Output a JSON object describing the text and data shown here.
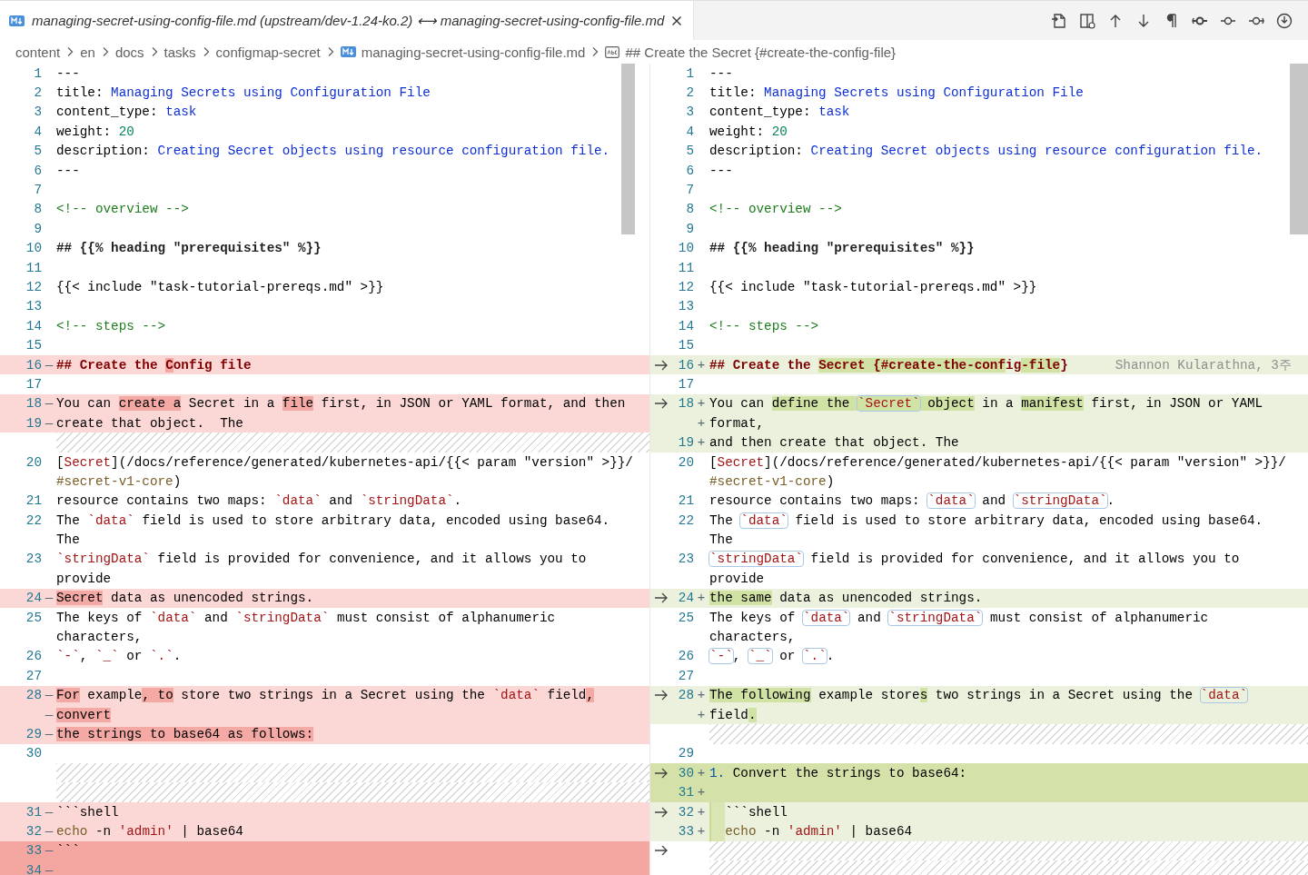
{
  "tab": {
    "title": "managing-secret-using-config-file.md (upstream/dev-1.24-ko.2) ⟷ managing-secret-using-config-file.md",
    "selected": true
  },
  "breadcrumbs": [
    {
      "label": "content",
      "kind": "folder"
    },
    {
      "label": "en",
      "kind": "folder"
    },
    {
      "label": "docs",
      "kind": "folder"
    },
    {
      "label": "tasks",
      "kind": "folder"
    },
    {
      "label": "configmap-secret",
      "kind": "folder"
    },
    {
      "label": "managing-secret-using-config-file.md",
      "kind": "file"
    },
    {
      "label": "## Create the Secret {#create-the-config-file}",
      "kind": "symbol"
    }
  ],
  "panes": [
    {
      "boxed_code": false,
      "rows": [
        {
          "kind": "plain",
          "num": "1",
          "segs": [
            {
              "text": "---"
            }
          ]
        },
        {
          "kind": "plain",
          "num": "2",
          "segs": [
            {
              "text": "title: "
            },
            {
              "text": "Managing Secrets using Configuration File",
              "kind": "value"
            }
          ]
        },
        {
          "kind": "plain",
          "num": "3",
          "segs": [
            {
              "text": "content_type: "
            },
            {
              "text": "task",
              "kind": "value"
            }
          ]
        },
        {
          "kind": "plain",
          "num": "4",
          "segs": [
            {
              "text": "weight: "
            },
            {
              "text": "20",
              "kind": "number"
            }
          ]
        },
        {
          "kind": "plain",
          "num": "5",
          "segs": [
            {
              "text": "description: "
            },
            {
              "text": "Creating Secret objects using resource configuration file.",
              "kind": "value"
            }
          ]
        },
        {
          "kind": "plain",
          "num": "6",
          "segs": [
            {
              "text": "---"
            }
          ]
        },
        {
          "kind": "plain",
          "num": "7",
          "segs": []
        },
        {
          "kind": "plain",
          "num": "8",
          "segs": [
            {
              "text": "<!-- overview -->",
              "kind": "comment"
            }
          ]
        },
        {
          "kind": "plain",
          "num": "9",
          "segs": []
        },
        {
          "kind": "plain",
          "num": "10",
          "segs": [
            {
              "text": "## {{% heading \"prerequisites\" %}}",
              "kind": "strong"
            }
          ]
        },
        {
          "kind": "plain",
          "num": "11",
          "segs": []
        },
        {
          "kind": "plain",
          "num": "12",
          "segs": [
            {
              "text": "{{< include \"task-tutorial-prereqs.md\" >}}"
            }
          ]
        },
        {
          "kind": "plain",
          "num": "13",
          "segs": []
        },
        {
          "kind": "plain",
          "num": "14",
          "segs": [
            {
              "text": "<!-- steps -->",
              "kind": "comment"
            }
          ]
        },
        {
          "kind": "plain",
          "num": "15",
          "segs": []
        },
        {
          "kind": "removed",
          "num": "16",
          "sign": "—",
          "segs": [
            {
              "text": "## Create the ",
              "kind": "heading"
            },
            {
              "text": "C",
              "kind": "heading",
              "changed": true
            },
            {
              "text": "onfig file",
              "kind": "heading"
            }
          ]
        },
        {
          "kind": "plain",
          "num": "17",
          "segs": []
        },
        {
          "kind": "removed",
          "num": "18",
          "sign": "—",
          "segs": [
            {
              "text": "You can "
            },
            {
              "text": "create a",
              "changed": true
            },
            {
              "text": " Secret in a "
            },
            {
              "text": "file",
              "changed": true
            },
            {
              "text": " first, in JSON or YAML format, and then"
            }
          ]
        },
        {
          "kind": "removed",
          "num": "19",
          "sign": "—",
          "segs": [
            {
              "text": "create that object.  The"
            }
          ]
        },
        {
          "kind": "filler"
        },
        {
          "kind": "plain",
          "num": "20",
          "segs": [
            {
              "text": "["
            },
            {
              "text": "Secret",
              "kind": "link"
            },
            {
              "text": "](/docs/reference/generated/kubernetes-api/{{< param \"version\" >}}/"
            }
          ]
        },
        {
          "kind": "plain",
          "segs": [
            {
              "text": "#secret-v1-core",
              "kind": "anchor"
            },
            {
              "text": ")"
            }
          ]
        },
        {
          "kind": "plain",
          "num": "21",
          "segs": [
            {
              "text": "resource contains two maps: "
            },
            {
              "text": "`data`",
              "kind": "code"
            },
            {
              "text": " and "
            },
            {
              "text": "`stringData`",
              "kind": "code"
            },
            {
              "text": "."
            }
          ]
        },
        {
          "kind": "plain",
          "num": "22",
          "segs": [
            {
              "text": "The "
            },
            {
              "text": "`data`",
              "kind": "code"
            },
            {
              "text": " field is used to store arbitrary data, encoded using base64."
            }
          ]
        },
        {
          "kind": "plain",
          "segs": [
            {
              "text": "The"
            }
          ]
        },
        {
          "kind": "plain",
          "num": "23",
          "segs": [
            {
              "text": "`stringData`",
              "kind": "code"
            },
            {
              "text": " field is provided for convenience, and it allows you to"
            }
          ]
        },
        {
          "kind": "plain",
          "segs": [
            {
              "text": "provide"
            }
          ]
        },
        {
          "kind": "removed",
          "num": "24",
          "sign": "—",
          "segs": [
            {
              "text": "Secret",
              "changed": true
            },
            {
              "text": " data as unencoded strings."
            }
          ]
        },
        {
          "kind": "plain",
          "num": "25",
          "segs": [
            {
              "text": "The keys of "
            },
            {
              "text": "`data`",
              "kind": "code"
            },
            {
              "text": " and "
            },
            {
              "text": "`stringData`",
              "kind": "code"
            },
            {
              "text": " must consist of alphanumeric"
            }
          ]
        },
        {
          "kind": "plain",
          "segs": [
            {
              "text": "characters,"
            }
          ]
        },
        {
          "kind": "plain",
          "num": "26",
          "segs": [
            {
              "text": "`-`",
              "kind": "code"
            },
            {
              "text": ", "
            },
            {
              "text": "`_`",
              "kind": "code"
            },
            {
              "text": " or "
            },
            {
              "text": "`.`",
              "kind": "code"
            },
            {
              "text": "."
            }
          ]
        },
        {
          "kind": "plain",
          "num": "27",
          "segs": []
        },
        {
          "kind": "removed",
          "num": "28",
          "sign": "—",
          "segs": [
            {
              "text": "For",
              "changed": true
            },
            {
              "text": " example"
            },
            {
              "text": ", to",
              "changed": true
            },
            {
              "text": " store two strings in a Secret using the "
            },
            {
              "text": "`data`",
              "kind": "code"
            },
            {
              "text": " field"
            },
            {
              "text": ",",
              "changed": true
            }
          ]
        },
        {
          "kind": "removed",
          "sign": "—",
          "segs": [
            {
              "text": "convert",
              "changed": true
            }
          ]
        },
        {
          "kind": "removed",
          "num": "29",
          "sign": "—",
          "segs": [
            {
              "text": "the strings to base64 as follows:",
              "changed": true
            }
          ]
        },
        {
          "kind": "plain",
          "num": "30",
          "segs": []
        },
        {
          "kind": "filler"
        },
        {
          "kind": "filler"
        },
        {
          "kind": "removed",
          "num": "31",
          "sign": "—",
          "segs": [
            {
              "text": "```shell"
            }
          ]
        },
        {
          "kind": "removed",
          "num": "32",
          "sign": "—",
          "segs": [
            {
              "text": "echo",
              "kind": "command"
            },
            {
              "text": " -n "
            },
            {
              "text": "'admin'",
              "kind": "string"
            },
            {
              "text": " | base64"
            }
          ]
        },
        {
          "kind": "removed_full",
          "num": "33",
          "sign": "—",
          "segs": [
            {
              "text": "```"
            }
          ]
        },
        {
          "kind": "removed_full",
          "num": "34",
          "sign": "—",
          "segs": []
        }
      ]
    },
    {
      "boxed_code": true,
      "rows": [
        {
          "kind": "plain",
          "num": "1",
          "segs": [
            {
              "text": "---"
            }
          ]
        },
        {
          "kind": "plain",
          "num": "2",
          "segs": [
            {
              "text": "title: "
            },
            {
              "text": "Managing Secrets using Configuration File",
              "kind": "value"
            }
          ]
        },
        {
          "kind": "plain",
          "num": "3",
          "segs": [
            {
              "text": "content_type: "
            },
            {
              "text": "task",
              "kind": "value"
            }
          ]
        },
        {
          "kind": "plain",
          "num": "4",
          "segs": [
            {
              "text": "weight: "
            },
            {
              "text": "20",
              "kind": "number"
            }
          ]
        },
        {
          "kind": "plain",
          "num": "5",
          "segs": [
            {
              "text": "description: "
            },
            {
              "text": "Creating Secret objects using resource configuration file.",
              "kind": "value"
            }
          ]
        },
        {
          "kind": "plain",
          "num": "6",
          "segs": [
            {
              "text": "---"
            }
          ]
        },
        {
          "kind": "plain",
          "num": "7",
          "segs": []
        },
        {
          "kind": "plain",
          "num": "8",
          "segs": [
            {
              "text": "<!-- overview -->",
              "kind": "comment"
            }
          ]
        },
        {
          "kind": "plain",
          "num": "9",
          "segs": []
        },
        {
          "kind": "plain",
          "num": "10",
          "segs": [
            {
              "text": "## {{% heading \"prerequisites\" %}}",
              "kind": "strong"
            }
          ]
        },
        {
          "kind": "plain",
          "num": "11",
          "segs": []
        },
        {
          "kind": "plain",
          "num": "12",
          "segs": [
            {
              "text": "{{< include \"task-tutorial-prereqs.md\" >}}"
            }
          ]
        },
        {
          "kind": "plain",
          "num": "13",
          "segs": []
        },
        {
          "kind": "plain",
          "num": "14",
          "segs": [
            {
              "text": "<!-- steps -->",
              "kind": "comment"
            }
          ]
        },
        {
          "kind": "plain",
          "num": "15",
          "segs": []
        },
        {
          "kind": "added",
          "arrow": true,
          "num": "16",
          "sign": "+",
          "blame": "Shannon Kularathna, 3주",
          "segs": [
            {
              "text": "## Create the ",
              "kind": "heading"
            },
            {
              "text": "Secret {#create-the-conf",
              "kind": "heading",
              "changed": true
            },
            {
              "text": "ig",
              "kind": "heading"
            },
            {
              "text": "-file",
              "kind": "heading",
              "changed": true
            },
            {
              "text": "}",
              "kind": "heading"
            }
          ]
        },
        {
          "kind": "plain",
          "num": "17",
          "segs": []
        },
        {
          "kind": "added",
          "arrow": true,
          "num": "18",
          "sign": "+",
          "segs": [
            {
              "text": "You can "
            },
            {
              "text": "define the ",
              "changed": true
            },
            {
              "text": "`Secret`",
              "kind": "code",
              "changed": true
            },
            {
              "text": " object",
              "changed": true
            },
            {
              "text": " in a "
            },
            {
              "text": "manifest",
              "changed": true
            },
            {
              "text": " first, in JSON or YAML"
            }
          ]
        },
        {
          "kind": "added",
          "sign": "+",
          "segs": [
            {
              "text": "format,"
            }
          ]
        },
        {
          "kind": "added",
          "num": "19",
          "sign": "+",
          "segs": [
            {
              "text": "and then create that object. The"
            }
          ]
        },
        {
          "kind": "plain",
          "num": "20",
          "segs": [
            {
              "text": "["
            },
            {
              "text": "Secret",
              "kind": "link"
            },
            {
              "text": "](/docs/reference/generated/kubernetes-api/{{< param \"version\" >}}/"
            }
          ]
        },
        {
          "kind": "plain",
          "segs": [
            {
              "text": "#secret-v1-core",
              "kind": "anchor"
            },
            {
              "text": ")"
            }
          ]
        },
        {
          "kind": "plain",
          "num": "21",
          "segs": [
            {
              "text": "resource contains two maps: "
            },
            {
              "text": "`data`",
              "kind": "code"
            },
            {
              "text": " and "
            },
            {
              "text": "`stringData`",
              "kind": "code"
            },
            {
              "text": "."
            }
          ]
        },
        {
          "kind": "plain",
          "num": "22",
          "segs": [
            {
              "text": "The "
            },
            {
              "text": "`data`",
              "kind": "code"
            },
            {
              "text": " field is used to store arbitrary data, encoded using base64."
            }
          ]
        },
        {
          "kind": "plain",
          "segs": [
            {
              "text": "The"
            }
          ]
        },
        {
          "kind": "plain",
          "num": "23",
          "segs": [
            {
              "text": "`stringData`",
              "kind": "code"
            },
            {
              "text": " field is provided for convenience, and it allows you to"
            }
          ]
        },
        {
          "kind": "plain",
          "segs": [
            {
              "text": "provide"
            }
          ]
        },
        {
          "kind": "added",
          "arrow": true,
          "num": "24",
          "sign": "+",
          "segs": [
            {
              "text": "the same",
              "changed": true
            },
            {
              "text": " data as unencoded strings."
            }
          ]
        },
        {
          "kind": "plain",
          "num": "25",
          "segs": [
            {
              "text": "The keys of "
            },
            {
              "text": "`data`",
              "kind": "code"
            },
            {
              "text": " and "
            },
            {
              "text": "`stringData`",
              "kind": "code"
            },
            {
              "text": " must consist of alphanumeric"
            }
          ]
        },
        {
          "kind": "plain",
          "segs": [
            {
              "text": "characters,"
            }
          ]
        },
        {
          "kind": "plain",
          "num": "26",
          "segs": [
            {
              "text": "`-`",
              "kind": "code"
            },
            {
              "text": ", "
            },
            {
              "text": "`_`",
              "kind": "code"
            },
            {
              "text": " or "
            },
            {
              "text": "`.`",
              "kind": "code"
            },
            {
              "text": "."
            }
          ]
        },
        {
          "kind": "plain",
          "num": "27",
          "segs": []
        },
        {
          "kind": "added",
          "arrow": true,
          "num": "28",
          "sign": "+",
          "segs": [
            {
              "text": "The following",
              "changed": true
            },
            {
              "text": " example store"
            },
            {
              "text": "s",
              "changed": true
            },
            {
              "text": " two strings in a Secret using the "
            },
            {
              "text": "`data`",
              "kind": "code"
            }
          ]
        },
        {
          "kind": "added",
          "sign": "+",
          "segs": [
            {
              "text": "field"
            },
            {
              "text": ".",
              "changed": true
            }
          ]
        },
        {
          "kind": "filler"
        },
        {
          "kind": "plain",
          "num": "29",
          "segs": []
        },
        {
          "kind": "added_full",
          "arrow": true,
          "num": "30",
          "sign": "+",
          "segs": [
            {
              "text": "1.",
              "kind": "list"
            },
            {
              "text": " Convert the strings to base64:"
            }
          ]
        },
        {
          "kind": "added_full",
          "num": "31",
          "sign": "+",
          "segs": []
        },
        {
          "kind": "added",
          "arrow": true,
          "num": "32",
          "sign": "+",
          "indented": true,
          "segs": [
            {
              "text": "```shell"
            }
          ]
        },
        {
          "kind": "added",
          "num": "33",
          "sign": "+",
          "indented": true,
          "segs": [
            {
              "text": "echo",
              "kind": "command"
            },
            {
              "text": " -n "
            },
            {
              "text": "'admin'",
              "kind": "string"
            },
            {
              "text": " | base64"
            }
          ]
        },
        {
          "kind": "filler",
          "arrow": true
        },
        {
          "kind": "filler"
        }
      ]
    }
  ]
}
